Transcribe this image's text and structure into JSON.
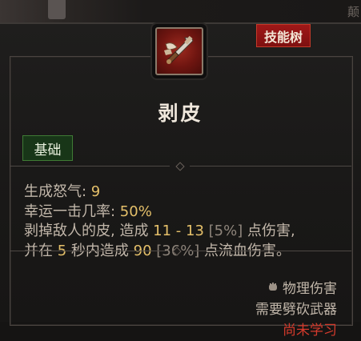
{
  "tab": {
    "label": "技能树"
  },
  "background": {
    "glyph": "颠"
  },
  "skill": {
    "title": "剥皮",
    "tag": "基础",
    "icon": "flay-skill-icon",
    "stats": {
      "fury_label": "生成怒气: ",
      "fury_value": "9",
      "lucky_label": "幸运一击几率: ",
      "lucky_value": "50%",
      "desc1_a": "剥掉敌人的皮, 造成 ",
      "desc1_dmg": "11 - 13",
      "desc1_pct": " [5%]",
      "desc1_b": " 点伤害,",
      "desc2_a": "并在 ",
      "desc2_sec": "5",
      "desc2_b": " 秒内造成 ",
      "desc2_dmg": "90",
      "desc2_pct": " [36%]",
      "desc2_c": " 点流血伤害。"
    },
    "damage_type": "物理伤害",
    "requirement": "需要劈砍武器",
    "status": "尚未学习"
  },
  "colors": {
    "tab_red": "#a01818",
    "tag_green": "#183618",
    "value_gold": "#e5c06a",
    "status_red": "#d43a2c"
  }
}
